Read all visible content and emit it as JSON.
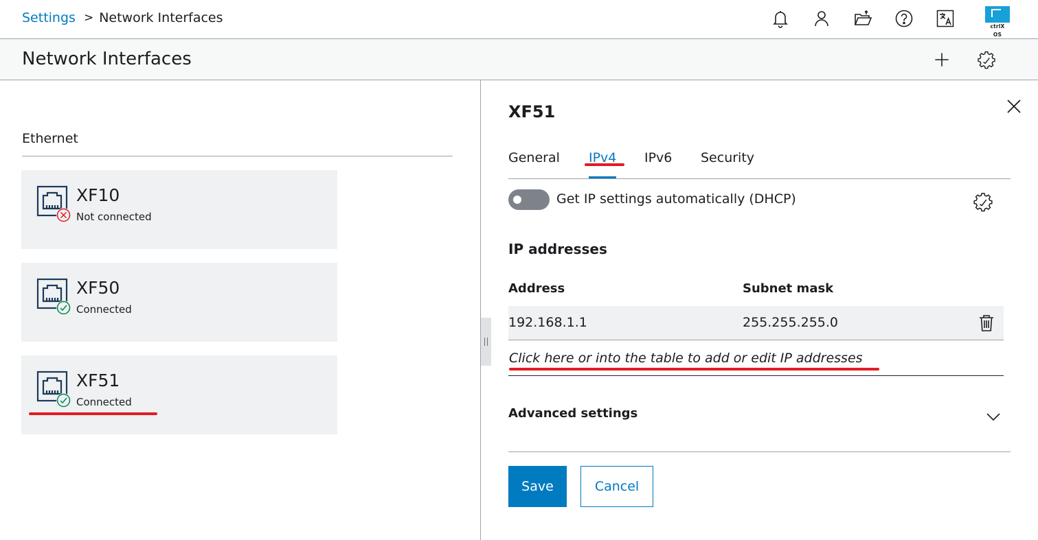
{
  "header": {
    "breadcrumb_root": "Settings",
    "breadcrumb_sep": ">",
    "breadcrumb_current": "Network Interfaces",
    "logo_text": "ctrlX OS",
    "icons": [
      "bell-icon",
      "user-icon",
      "folder-icon",
      "help-icon",
      "language-icon"
    ]
  },
  "titlebar": {
    "title": "Network Interfaces",
    "actions": [
      "add-icon",
      "gear-icon"
    ]
  },
  "left": {
    "section": "Ethernet",
    "interfaces": [
      {
        "name": "XF10",
        "status": "Not connected",
        "state": "error"
      },
      {
        "name": "XF50",
        "status": "Connected",
        "state": "ok"
      },
      {
        "name": "XF51",
        "status": "Connected",
        "state": "ok"
      }
    ]
  },
  "detail": {
    "title": "XF51",
    "tabs": [
      "General",
      "IPv4",
      "IPv6",
      "Security"
    ],
    "active_tab": "IPv4",
    "dhcp_label": "Get IP settings automatically (DHCP)",
    "dhcp_enabled": false,
    "ip_heading": "IP addresses",
    "columns": {
      "address": "Address",
      "subnet": "Subnet mask"
    },
    "rows": [
      {
        "address": "192.168.1.1",
        "subnet": "255.255.255.0"
      }
    ],
    "add_hint": "Click here or into the table to add or edit IP addresses",
    "advanced_label": "Advanced settings",
    "save_label": "Save",
    "cancel_label": "Cancel"
  },
  "colors": {
    "accent": "#007bc0",
    "ok": "#00884a",
    "error": "#e21b24",
    "card_bg": "#eff1f2",
    "annotation": "#e21b24"
  }
}
